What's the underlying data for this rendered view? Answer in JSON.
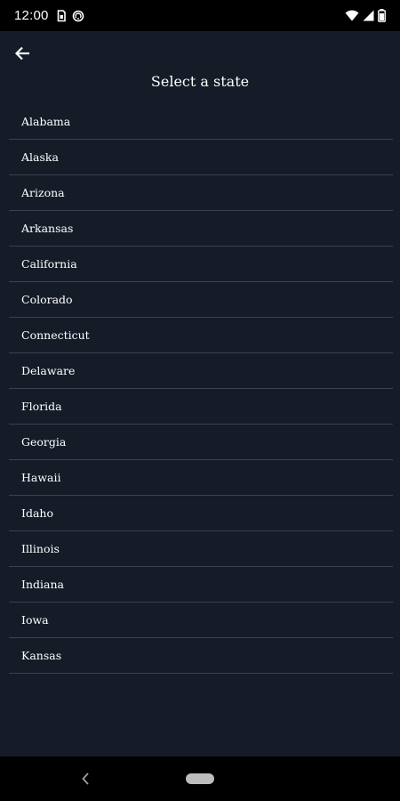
{
  "status_bar": {
    "time": "12:00",
    "icons": [
      "sim-card-icon",
      "sync-icon",
      "wifi-icon",
      "signal-icon",
      "battery-icon"
    ]
  },
  "app_bar": {
    "back_icon": "arrow-left-icon",
    "title": "Select a state"
  },
  "states": [
    "Alabama",
    "Alaska",
    "Arizona",
    "Arkansas",
    "California",
    "Colorado",
    "Connecticut",
    "Delaware",
    "Florida",
    "Georgia",
    "Hawaii",
    "Idaho",
    "Illinois",
    "Indiana",
    "Iowa",
    "Kansas"
  ],
  "nav_bar": {
    "icons": [
      "nav-back-icon",
      "home-pill-icon"
    ]
  },
  "colors": {
    "background": "#151c28",
    "divider": "#3a4250",
    "system_bar": "#000000",
    "text": "#ffffff"
  }
}
